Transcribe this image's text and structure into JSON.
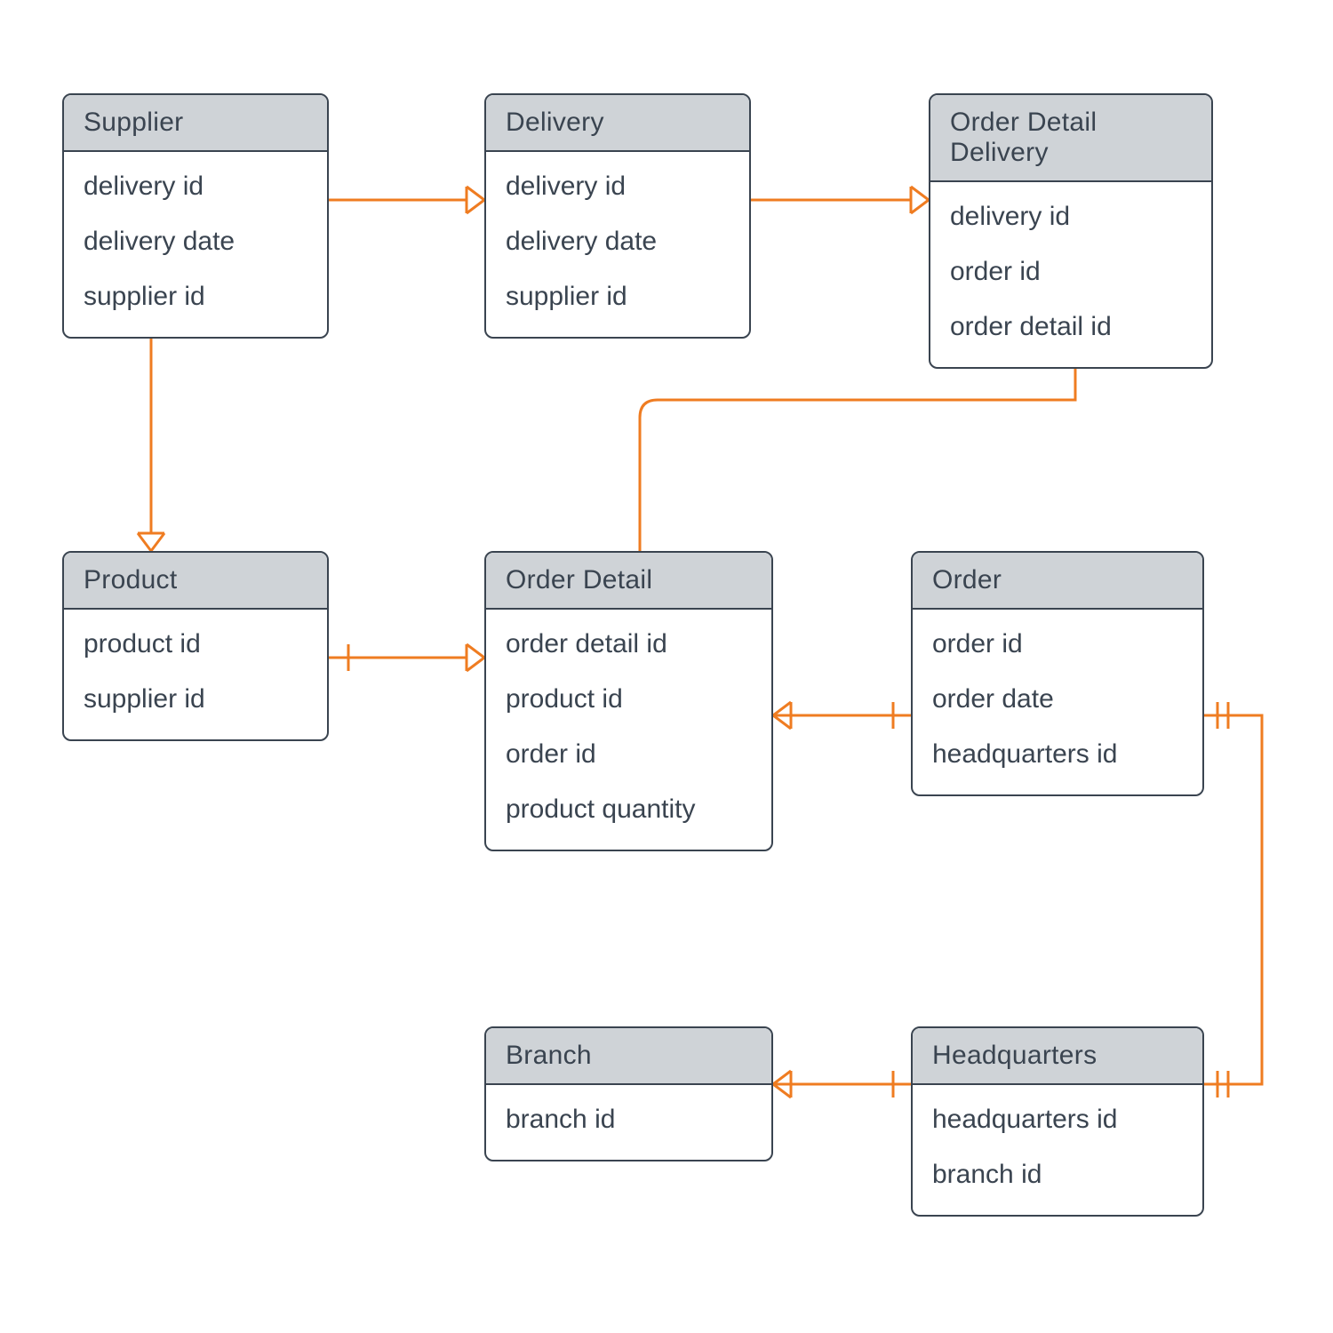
{
  "diagram_type": "Entity-Relationship Diagram",
  "entities": {
    "supplier": {
      "title": "Supplier",
      "attrs": [
        "delivery id",
        "delivery date",
        "supplier id"
      ]
    },
    "delivery": {
      "title": "Delivery",
      "attrs": [
        "delivery id",
        "delivery date",
        "supplier id"
      ]
    },
    "order_detail_delivery": {
      "title": "Order Detail Delivery",
      "attrs": [
        "delivery id",
        "order id",
        "order detail id"
      ]
    },
    "product": {
      "title": "Product",
      "attrs": [
        "product id",
        "supplier id"
      ]
    },
    "order_detail": {
      "title": "Order Detail",
      "attrs": [
        "order detail id",
        "product id",
        "order id",
        "product quantity"
      ]
    },
    "order": {
      "title": "Order",
      "attrs": [
        "order id",
        "order date",
        "headquarters id"
      ]
    },
    "branch": {
      "title": "Branch",
      "attrs": [
        "branch id"
      ]
    },
    "headquarters": {
      "title": "Headquarters",
      "attrs": [
        "headquarters id",
        "branch id"
      ]
    }
  },
  "relationships": [
    {
      "from": "supplier",
      "to": "delivery",
      "type": "one-to-many"
    },
    {
      "from": "delivery",
      "to": "order_detail_delivery",
      "type": "one-to-many"
    },
    {
      "from": "supplier",
      "to": "product",
      "type": "one-to-many"
    },
    {
      "from": "product",
      "to": "order_detail",
      "type": "one-to-many"
    },
    {
      "from": "order_detail",
      "to": "order_detail_delivery",
      "type": "one-to-many"
    },
    {
      "from": "order",
      "to": "order_detail",
      "type": "one-to-many"
    },
    {
      "from": "headquarters",
      "to": "order",
      "type": "one-to-one"
    },
    {
      "from": "headquarters",
      "to": "branch",
      "type": "one-to-many"
    }
  ],
  "colors": {
    "connector": "#ef7c21",
    "border": "#3a4450",
    "title_bg": "#cfd3d7"
  }
}
